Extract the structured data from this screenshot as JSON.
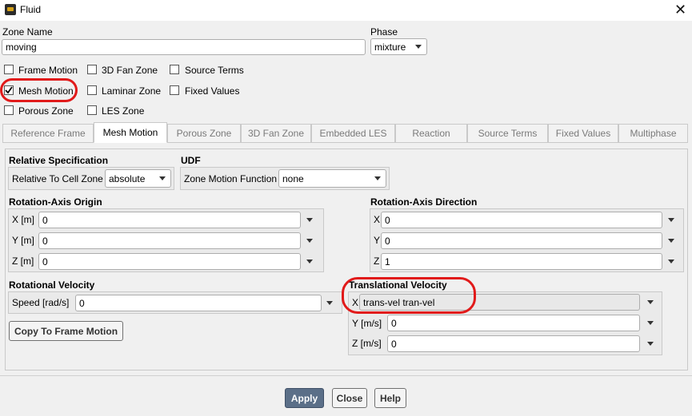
{
  "window": {
    "title": "Fluid"
  },
  "zone": {
    "label": "Zone Name",
    "value": "moving"
  },
  "phase": {
    "label": "Phase",
    "value": "mixture"
  },
  "checkboxes": [
    {
      "label": "Frame Motion",
      "checked": false
    },
    {
      "label": "3D Fan Zone",
      "checked": false
    },
    {
      "label": "Source Terms",
      "checked": false
    },
    {
      "label": "Mesh Motion",
      "checked": true
    },
    {
      "label": "Laminar Zone",
      "checked": false
    },
    {
      "label": "Fixed Values",
      "checked": false
    },
    {
      "label": "Porous Zone",
      "checked": false
    },
    {
      "label": "LES Zone",
      "checked": false
    }
  ],
  "tabs": [
    {
      "label": "Reference Frame"
    },
    {
      "label": "Mesh Motion"
    },
    {
      "label": "Porous Zone"
    },
    {
      "label": "3D Fan Zone"
    },
    {
      "label": "Embedded LES"
    },
    {
      "label": "Reaction"
    },
    {
      "label": "Source Terms"
    },
    {
      "label": "Fixed Values"
    },
    {
      "label": "Multiphase"
    }
  ],
  "active_tab": "Mesh Motion",
  "relative_spec": {
    "title": "Relative Specification",
    "label": "Relative To Cell Zone",
    "value": "absolute"
  },
  "udf": {
    "title": "UDF",
    "label": "Zone Motion Function",
    "value": "none"
  },
  "axis_origin": {
    "title": "Rotation-Axis Origin",
    "fields": [
      {
        "label": "X [m]",
        "value": "0"
      },
      {
        "label": "Y [m]",
        "value": "0"
      },
      {
        "label": "Z [m]",
        "value": "0"
      }
    ]
  },
  "axis_direction": {
    "title": "Rotation-Axis Direction",
    "fields": [
      {
        "label": "X",
        "value": "0"
      },
      {
        "label": "Y",
        "value": "0"
      },
      {
        "label": "Z",
        "value": "1"
      }
    ]
  },
  "rot_velocity": {
    "title": "Rotational Velocity",
    "label": "Speed [rad/s]",
    "value": "0"
  },
  "copy_button": "Copy To Frame Motion",
  "trans_velocity": {
    "title": "Translational Velocity",
    "fields": [
      {
        "label": "X",
        "value": "trans-vel tran-vel"
      },
      {
        "label": "Y [m/s]",
        "value": "0"
      },
      {
        "label": "Z [m/s]",
        "value": "0"
      }
    ]
  },
  "footer": {
    "apply": "Apply",
    "close": "Close",
    "help": "Help"
  },
  "colors": {
    "annotation": "#e11a1a",
    "apply_button": "#5b6f88",
    "checkmark": "#000000"
  }
}
